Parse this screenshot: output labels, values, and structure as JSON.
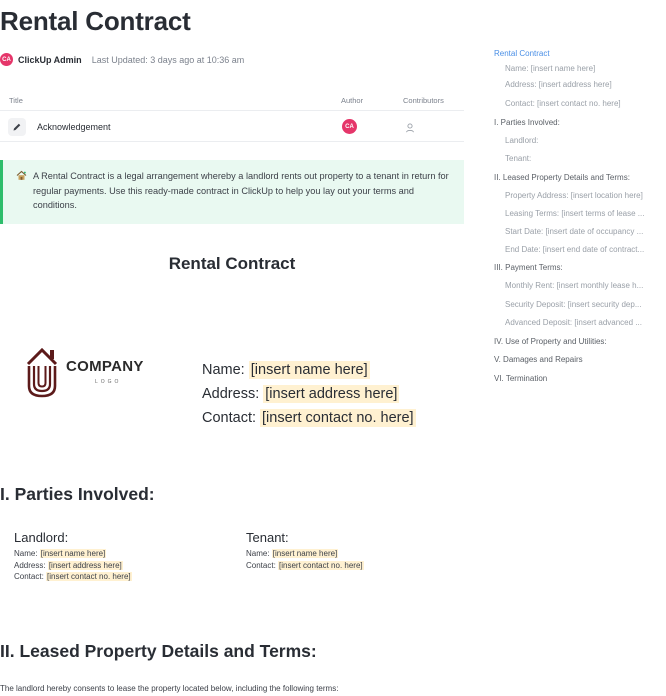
{
  "doc": {
    "title": "Rental Contract",
    "author_initials": "CA",
    "author": "ClickUp Admin",
    "last_updated": "Last Updated: 3 days ago at 10:36 am"
  },
  "table": {
    "headers": {
      "title": "Title",
      "author": "Author",
      "contributors": "Contributors"
    },
    "rows": [
      {
        "title": "Acknowledgement",
        "author_initials": "CA",
        "icon": "pencil-icon"
      }
    ]
  },
  "callout": {
    "icon": "house-icon",
    "text": "A Rental Contract is a legal arrangement whereby a landlord rents out property to a tenant in return for regular payments. Use this ready-made contract in ClickUp to help you lay out your terms and conditions."
  },
  "contract": {
    "heading": "Rental Contract",
    "logo_text": "COMPANY",
    "logo_sub": "LOGO",
    "name_label": "Name:",
    "name_value": "[insert name here]",
    "address_label": "Address:",
    "address_value": "[insert address here]",
    "contact_label": "Contact:",
    "contact_value": "[insert contact no. here]"
  },
  "parties": {
    "heading": "I. Parties Involved:",
    "landlord": {
      "title": "Landlord:",
      "name_label": "Name:",
      "name_value": "[insert name here]",
      "address_label": "Address:",
      "address_value": "[insert address here]",
      "contact_label": "Contact:",
      "contact_value": "[insert contact no. here]"
    },
    "tenant": {
      "title": "Tenant:",
      "name_label": "Name:",
      "name_value": "[insert name here]",
      "contact_label": "Contact:",
      "contact_value": "[insert contact no. here]"
    }
  },
  "leased": {
    "heading": "II. Leased Property Details and Terms:",
    "intro": "The landlord hereby consents to lease the property located below, including the following terms:"
  },
  "toc": {
    "items": [
      {
        "label": "Rental Contract",
        "level": "top"
      },
      {
        "label": "Name: [insert name here]",
        "level": "sub"
      },
      {
        "label": "Address: [insert address here]",
        "level": "sub"
      },
      {
        "label": "Contact: [insert contact no. here]",
        "level": "sub"
      },
      {
        "label": "I. Parties Involved:",
        "level": "sec"
      },
      {
        "label": "Landlord:",
        "level": "sub"
      },
      {
        "label": "Tenant:",
        "level": "sub"
      },
      {
        "label": "II. Leased Property Details and Terms:",
        "level": "sec"
      },
      {
        "label": "Property Address: [insert location here]",
        "level": "sub"
      },
      {
        "label": "Leasing Terms: [insert terms of lease ...",
        "level": "sub"
      },
      {
        "label": "Start Date: [insert date of occupancy ...",
        "level": "sub"
      },
      {
        "label": "End Date: [insert end date of contract...",
        "level": "sub"
      },
      {
        "label": "III. Payment Terms:",
        "level": "sec"
      },
      {
        "label": "Monthly Rent: [insert monthly lease h...",
        "level": "sub"
      },
      {
        "label": "Security Deposit: [insert security dep...",
        "level": "sub"
      },
      {
        "label": "Advanced Deposit: [insert advanced ...",
        "level": "sub"
      },
      {
        "label": "IV. Use of Property and Utilities:",
        "level": "sec"
      },
      {
        "label": "V. Damages and Repairs",
        "level": "sec"
      },
      {
        "label": "VI. Termination",
        "level": "sec"
      }
    ]
  },
  "colors": {
    "accent": "#4a8fe6",
    "avatar": "#e5366a",
    "callout_bg": "#e9f9f1",
    "callout_border": "#2ebd6b",
    "highlight": "#fff1d1",
    "logo": "#5c1a1a"
  }
}
